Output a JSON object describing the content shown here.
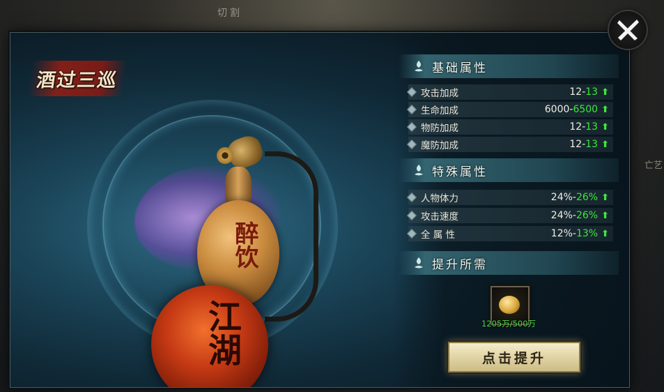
{
  "background": {
    "top_label": "切割",
    "right_label": "亡艺"
  },
  "dialog": {
    "title": "酒过三巡",
    "item": {
      "top_text": "醉饮",
      "bottom_text": "江湖"
    },
    "sections": {
      "basic": {
        "title": "基础属性",
        "rows": [
          {
            "label": "攻击加成",
            "current": "12",
            "sep": "-",
            "next": "13"
          },
          {
            "label": "生命加成",
            "current": "6000",
            "sep": "-",
            "next": "6500"
          },
          {
            "label": "物防加成",
            "current": "12",
            "sep": "-",
            "next": "13"
          },
          {
            "label": "魔防加成",
            "current": "12",
            "sep": "-",
            "next": "13"
          }
        ]
      },
      "special": {
        "title": "特殊属性",
        "rows": [
          {
            "label": "人物体力",
            "current": "24%",
            "sep": "-",
            "next": "26%"
          },
          {
            "label": "攻击速度",
            "current": "24%",
            "sep": "-",
            "next": "26%"
          },
          {
            "label": "全 属 性",
            "current": "12%",
            "sep": "-",
            "next": "13%"
          }
        ]
      },
      "requirement": {
        "title": "提升所需",
        "cost_text": "1205万/500万"
      }
    },
    "upgrade_button": "点击提升",
    "arrow_glyph": "⬆"
  },
  "colors": {
    "increase_green": "#3ce83c",
    "button_face": "#e3d6a8"
  }
}
